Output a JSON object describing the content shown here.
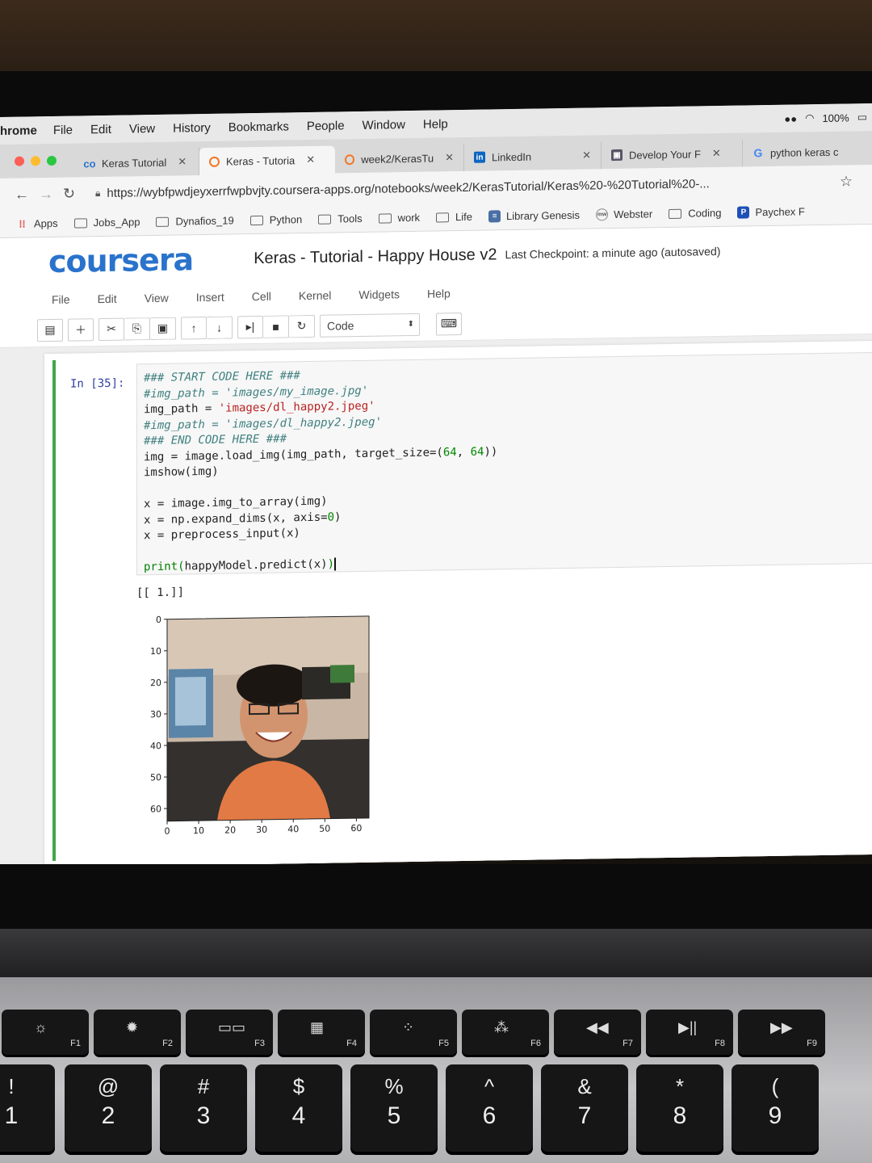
{
  "mac_menubar": {
    "app": "hrome",
    "items": [
      "File",
      "Edit",
      "View",
      "History",
      "Bookmarks",
      "People",
      "Window",
      "Help"
    ],
    "battery": "100%"
  },
  "tabs": [
    {
      "label": "Keras Tutorial",
      "icon": "coursera-icon",
      "close": "✕"
    },
    {
      "label": "Keras - Tutoria",
      "icon": "jupyter-loading-icon",
      "close": "✕"
    },
    {
      "label": "week2/KerasTu",
      "icon": "jupyter-loading-icon",
      "close": "✕"
    },
    {
      "label": "LinkedIn",
      "icon": "linkedin-icon",
      "close": "✕"
    },
    {
      "label": "Develop Your F",
      "icon": "site-icon",
      "close": "✕"
    },
    {
      "label": "python keras c",
      "icon": "google-icon",
      "close": ""
    }
  ],
  "address": {
    "url": "https://wybfpwdjeyxerrfwpbvjty.coursera-apps.org/notebooks/week2/KerasTutorial/Keras%20-%20Tutorial%20-..."
  },
  "bookmarks": [
    {
      "label": "Apps",
      "icon": "apps-grid-icon"
    },
    {
      "label": "Jobs_App",
      "icon": "folder-icon"
    },
    {
      "label": "Dynafios_19",
      "icon": "folder-icon"
    },
    {
      "label": "Python",
      "icon": "folder-icon"
    },
    {
      "label": "Tools",
      "icon": "folder-icon"
    },
    {
      "label": "work",
      "icon": "folder-icon"
    },
    {
      "label": "Life",
      "icon": "folder-icon"
    },
    {
      "label": "Library Genesis",
      "icon": "library-icon"
    },
    {
      "label": "Webster",
      "icon": "webster-icon"
    },
    {
      "label": "Coding",
      "icon": "folder-icon"
    },
    {
      "label": "Paychex F",
      "icon": "paychex-icon"
    }
  ],
  "notebook": {
    "logo": "coursera",
    "title": "Keras - Tutorial - Happy House v2",
    "checkpoint": "Last Checkpoint: a minute ago (autosaved)",
    "menu": [
      "File",
      "Edit",
      "View",
      "Insert",
      "Cell",
      "Kernel",
      "Widgets",
      "Help"
    ],
    "cell_type": "Code",
    "prompt": "In [35]:",
    "code": {
      "l1": "### START CODE HERE ###",
      "l2": "#img_path = 'images/my_image.jpg'",
      "l3a": "img_path = ",
      "l3b": "'images/dl_happy2.jpeg'",
      "l4": "#img_path = 'images/dl_happy2.jpeg'",
      "l5": "### END CODE HERE ###",
      "l6a": "img = image.load_img(img_path, target_size=(",
      "l6b": "64",
      "l6c": ", ",
      "l6d": "64",
      "l6e": "))",
      "l7": "imshow(img)",
      "l8": "x = image.img_to_array(img)",
      "l9a": "x = np.expand_dims(x, axis=",
      "l9b": "0",
      "l9c": ")",
      "l10": "x = preprocess_input(x)",
      "l11a": "print",
      "l11b": "(",
      "l11c": "happyModel.predict(x)",
      "l11d": ")"
    },
    "output": "[[ 1.]]"
  },
  "chart_data": {
    "type": "image",
    "x_ticks": [
      "0",
      "10",
      "20",
      "30",
      "40",
      "50",
      "60"
    ],
    "y_ticks": [
      "0",
      "10",
      "20",
      "30",
      "40",
      "50",
      "60"
    ],
    "xlim": [
      0,
      64
    ],
    "ylim": [
      64,
      0
    ]
  },
  "keyboard": {
    "fkeys": [
      {
        "icon": "☼",
        "label": "F1"
      },
      {
        "icon": "✹",
        "label": "F2"
      },
      {
        "icon": "▭▭",
        "label": "F3"
      },
      {
        "icon": "▦",
        "label": "F4"
      },
      {
        "icon": "⁘",
        "label": "F5"
      },
      {
        "icon": "⁂",
        "label": "F6"
      },
      {
        "icon": "◀◀",
        "label": "F7"
      },
      {
        "icon": "▶||",
        "label": "F8"
      },
      {
        "icon": "▶▶",
        "label": "F9"
      }
    ],
    "numkeys": [
      {
        "sym": "!",
        "dig": "1"
      },
      {
        "sym": "@",
        "dig": "2"
      },
      {
        "sym": "#",
        "dig": "3"
      },
      {
        "sym": "$",
        "dig": "4"
      },
      {
        "sym": "%",
        "dig": "5"
      },
      {
        "sym": "^",
        "dig": "6"
      },
      {
        "sym": "&",
        "dig": "7"
      },
      {
        "sym": "*",
        "dig": "8"
      },
      {
        "sym": "(",
        "dig": "9"
      }
    ]
  },
  "colors": {
    "coursera_blue": "#2a73cc",
    "cell_selected": "#42a54b"
  }
}
